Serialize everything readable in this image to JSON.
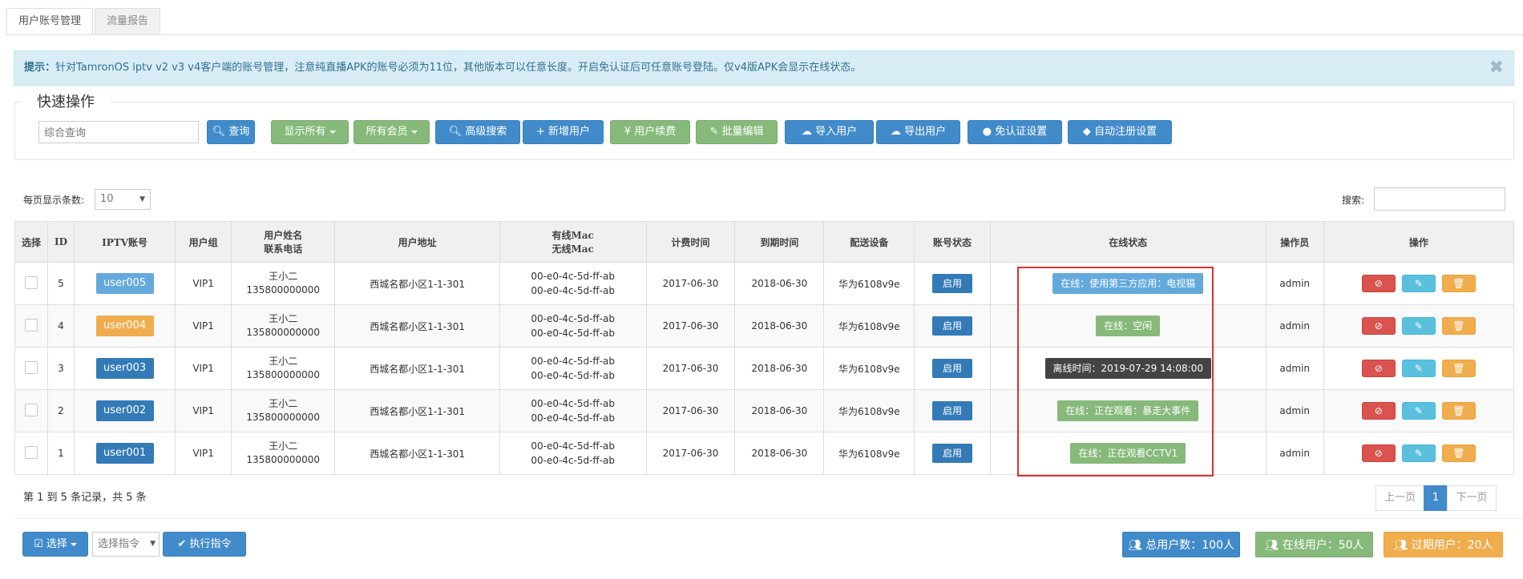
{
  "tabs": [
    "用户账号管理",
    "流量报告"
  ],
  "alert": {
    "prefix": "提示：",
    "text": "针对TamronOS iptv v2 v3 v4客户端的账号管理，注意纯直播APK的账号必须为11位，其他版本可以任意长度。开启免认证后可任意账号登陆。仅v4版APK会显示在线状态。",
    "close": "✖"
  },
  "quick_ops": {
    "legend": "快速操作",
    "search_placeholder": "综合查询",
    "query_btn": "查询",
    "buttons": [
      "显示所有",
      "所有会员",
      "高级搜索",
      "新增用户",
      "用户续费",
      "批量编辑",
      "导入用户",
      "导出用户",
      "免认证设置",
      "自动注册设置"
    ]
  },
  "list_controls": {
    "page_size_label": "每页显示条数:",
    "page_size_value": "10",
    "search_label": "搜索:"
  },
  "table": {
    "headers": [
      "选择",
      "ID",
      "IPTV账号",
      "用户组",
      "用户姓名",
      "联系电话",
      "用户地址",
      "有线Mac",
      "无线Mac",
      "计费时间",
      "到期时间",
      "配送设备",
      "账号状态",
      "在线状态",
      "操作员",
      "操作"
    ],
    "rows": [
      {
        "id": "5",
        "account": "user005",
        "account_color": "#64a9dd",
        "group": "VIP1",
        "name": "王小二",
        "phone": "135800000000",
        "address": "西城名都小区1-1-301",
        "wired_mac": "00-e0-4c-5d-ff-ab",
        "wireless_mac": "00-e0-4c-5d-ff-ab",
        "start": "2017-06-30",
        "expire": "2018-06-30",
        "device": "华为6108v9e",
        "status": "启用",
        "online": "在线：使用第三方应用：电视猫",
        "online_color": "#64a9dd",
        "operator": "admin"
      },
      {
        "id": "4",
        "account": "user004",
        "account_color": "#f0ad4e",
        "group": "VIP1",
        "name": "王小二",
        "phone": "135800000000",
        "address": "西城名都小区1-1-301",
        "wired_mac": "00-e0-4c-5d-ff-ab",
        "wireless_mac": "00-e0-4c-5d-ff-ab",
        "start": "2017-06-30",
        "expire": "2018-06-30",
        "device": "华为6108v9e",
        "status": "启用",
        "online": "在线：空闲",
        "online_color": "#86b97a",
        "operator": "admin"
      },
      {
        "id": "3",
        "account": "user003",
        "account_color": "#337ab7",
        "group": "VIP1",
        "name": "王小二",
        "phone": "135800000000",
        "address": "西城名都小区1-1-301",
        "wired_mac": "00-e0-4c-5d-ff-ab",
        "wireless_mac": "00-e0-4c-5d-ff-ab",
        "start": "2017-06-30",
        "expire": "2018-06-30",
        "device": "华为6108v9e",
        "status": "启用",
        "online": "离线时间：2019-07-29 14:08:00",
        "online_color": "#444444",
        "operator": "admin"
      },
      {
        "id": "2",
        "account": "user002",
        "account_color": "#337ab7",
        "group": "VIP1",
        "name": "王小二",
        "phone": "135800000000",
        "address": "西城名都小区1-1-301",
        "wired_mac": "00-e0-4c-5d-ff-ab",
        "wireless_mac": "00-e0-4c-5d-ff-ab",
        "start": "2017-06-30",
        "expire": "2018-06-30",
        "device": "华为6108v9e",
        "status": "启用",
        "online": "在线：正在观看：暴走大事件",
        "online_color": "#86b97a",
        "operator": "admin"
      },
      {
        "id": "1",
        "account": "user001",
        "account_color": "#337ab7",
        "group": "VIP1",
        "name": "王小二",
        "phone": "135800000000",
        "address": "西城名都小区1-1-301",
        "wired_mac": "00-e0-4c-5d-ff-ab",
        "wireless_mac": "00-e0-4c-5d-ff-ab",
        "start": "2017-06-30",
        "expire": "2018-06-30",
        "device": "华为6108v9e",
        "status": "启用",
        "online": "在线：正在观看CCTV1",
        "online_color": "#86b97a",
        "operator": "admin"
      }
    ],
    "action_icons": [
      "ban-icon",
      "edit-icon",
      "trash-icon"
    ]
  },
  "footer": {
    "summary": "第 1 到 5 条记录，共 5 条",
    "prev": "上一页",
    "page": "1",
    "next": "下一页"
  },
  "bottom": {
    "select_btn": "选择",
    "command_placeholder": "选择指令",
    "exec_btn": "执行指令",
    "total_users": "总用户数：100人",
    "online_users": "在线用户：50人",
    "expired_users": "过期用户：20人"
  },
  "colors": {
    "blue": "#337ab7",
    "green": "#86b97a",
    "orange": "#f0ad4e",
    "red": "#d9534f",
    "highlight_box": "#e03030"
  }
}
